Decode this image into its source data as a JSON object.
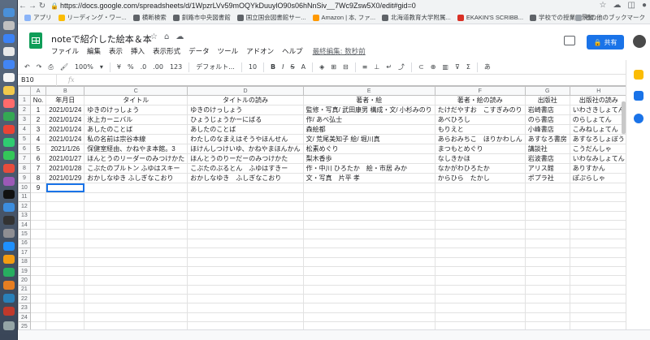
{
  "browser": {
    "url": "https://docs.google.com/spreadsheets/d/1WpzrLVv59mOQYkDuuylO90s06hNnSiv__7Wc9Zsw5X0/edit#gid=0",
    "bookmarks": [
      {
        "label": "アプリ",
        "color": "#8ab4f8"
      },
      {
        "label": "リーディング・ワー...",
        "color": "#fbbc04"
      },
      {
        "label": "横断検索",
        "color": "#5f6368"
      },
      {
        "label": "釧路市中央図書館",
        "color": "#5f6368"
      },
      {
        "label": "国立国会図書館サー...",
        "color": "#5f6368"
      },
      {
        "label": "Amazon | 本, ファ...",
        "color": "#ff9900"
      },
      {
        "label": "北海道教育大学附属...",
        "color": "#5f6368"
      },
      {
        "label": "EKAKIN'S SCRIBB...",
        "color": "#d93025"
      },
      {
        "label": "学校での授業風景動...",
        "color": "#5f6368"
      }
    ],
    "other_bookmarks": "その他のブックマーク"
  },
  "doc": {
    "title": "noteで紹介した絵本＆本",
    "menu": [
      "ファイル",
      "編集",
      "表示",
      "挿入",
      "表示形式",
      "データ",
      "ツール",
      "アドオン",
      "ヘルプ"
    ],
    "last_edit": "最終編集: 数秒前",
    "share_label": "共有"
  },
  "toolbar": {
    "zoom": "100%",
    "currency": "¥",
    "percent": "%",
    "dec_less": ".0",
    "dec_more": ".00",
    "number_format": "123",
    "font": "デフォルト...",
    "font_size": "10",
    "bold": "B",
    "italic": "I",
    "strike": "S",
    "text_color": "A",
    "input_tool": "あ"
  },
  "formula_bar": {
    "cell_ref": "B10",
    "fx": "fx",
    "content": ""
  },
  "sheet": {
    "columns": [
      "A",
      "B",
      "C",
      "D",
      "E",
      "F",
      "G",
      "H"
    ],
    "header_row": [
      "No.",
      "年月日",
      "タイトル",
      "タイトルの読み",
      "著者・絵",
      "著者・絵の読み",
      "出版社",
      "出版社の読み"
    ],
    "rows": [
      [
        "1",
        "2021/01/24",
        "ゆきのけっしょう",
        "ゆきのけっしょう",
        "監修・写真/ 武田康男 構成・文/ 小杉みのり",
        "たけだやすお　こすぎみのり",
        "岩崎書店",
        "いわさきしょてん"
      ],
      [
        "2",
        "2021/01/24",
        "氷上カーニバル",
        "ひょうじょうかーにばる",
        "作/ あべ弘士",
        "あべひろし",
        "のら書店",
        "のらしょてん"
      ],
      [
        "3",
        "2021/01/24",
        "あしたのことば",
        "あしたのことば",
        "森絵都",
        "もりえと",
        "小峰書店",
        "こみねしょてん"
      ],
      [
        "4",
        "2021/01/24",
        "私の名前は宗谷本線",
        "わたしのなまえはそうやほんせん",
        "文/ 荒尾美知子 絵/ 堀川真",
        "あらおみちこ　ほりかわしん",
        "あすなろ書房",
        "あすなろしょぼう"
      ],
      [
        "5",
        "2021/1/26",
        "保健室経由、かねやま本館。3",
        "ほけんしつけいゆ、かねやまほんかん",
        "松素めぐり",
        "まつもとめぐり",
        "講談社",
        "こうだんしゃ"
      ],
      [
        "6",
        "2021/01/27",
        "ほんとうのリーダーのみつけかた",
        "ほんとうのりーだーのみつけかた",
        "梨木香歩",
        "なしきかほ",
        "岩波書店",
        "いわなみしょてん"
      ],
      [
        "7",
        "2021/01/28",
        "こぶたのブルトン ふゆはスキー",
        "こぶたのぶるとん　ふゆはすきー",
        "作・中川 ひろたか　絵・市居 みか",
        "なかがわひろたか",
        "アリス館",
        "ありすかん"
      ],
      [
        "8",
        "2021/01/29",
        "おかしなゆき ふしぎなこおり",
        "おかしなゆき　ふしぎなこおり",
        "文・写真　片平 孝",
        "からひら　たかし",
        "ポプラ社",
        "ぽぷらしゃ"
      ],
      [
        "9",
        "",
        "",
        "",
        "",
        "",
        "",
        ""
      ]
    ],
    "row_numbers": [
      "1",
      "2",
      "3",
      "4",
      "5",
      "6",
      "7",
      "8",
      "9",
      "10",
      "11",
      "12",
      "13",
      "14",
      "15",
      "16",
      "17",
      "18",
      "19",
      "20",
      "21",
      "22",
      "23",
      "24",
      "25"
    ]
  }
}
